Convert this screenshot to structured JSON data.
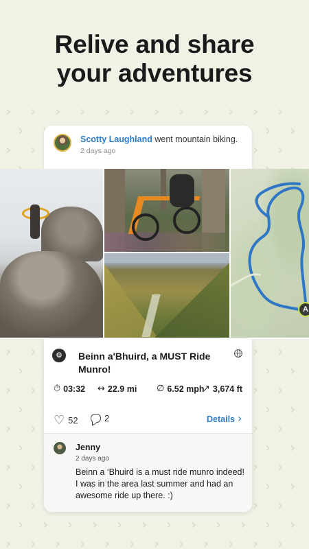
{
  "headline": {
    "line1": "Relive and share",
    "line2": "your adventures"
  },
  "activity": {
    "user_name": "Scotty Laughland",
    "action": " went mountain biking.",
    "time": "2 days ago",
    "title": "Beinn a'Bhuird, a MUST Ride Munro!",
    "map_marker": "A",
    "stats": {
      "time": "03:32",
      "distance": "22.9 mi",
      "avg_speed": "6.52 mph",
      "elevation": "3,674 ft"
    },
    "likes": "52",
    "comments": "2",
    "details_label": "Details"
  },
  "comment": {
    "author": "Jenny",
    "time": "2 days ago",
    "text": "Beinn a ‘Bhuird is a must ride munro indeed! I was in the area last summer and had an awesome ride up there. :)"
  },
  "colors": {
    "background": "#f1f1e6",
    "link_blue": "#2d7cc8",
    "route_blue": "#2f77c6"
  },
  "icons": [
    "mountain-bike-icon",
    "globe-icon",
    "stopwatch-icon",
    "distance-arrows-icon",
    "average-speed-icon",
    "elevation-arrow-icon",
    "heart-icon",
    "comment-icon",
    "chevron-right-icon"
  ]
}
